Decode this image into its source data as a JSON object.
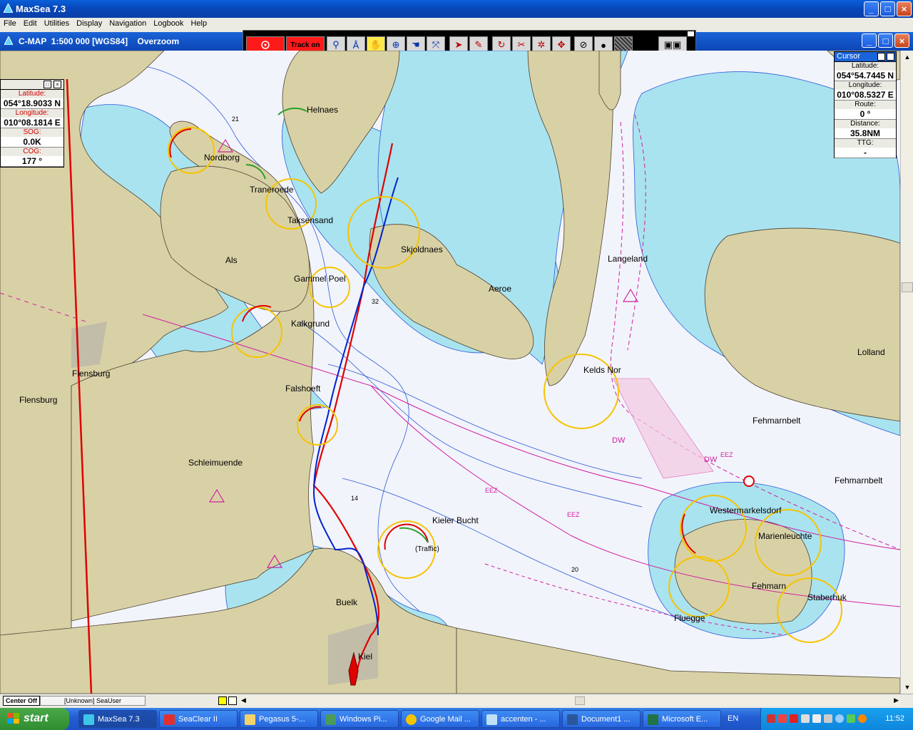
{
  "window": {
    "title": "MaxSea 7.3"
  },
  "menu": [
    "File",
    "Edit",
    "Utilities",
    "Display",
    "Navigation",
    "Logbook",
    "Help"
  ],
  "chart_header": {
    "title": "C-MAP  1:500 000 [WGS84]    Overzoom"
  },
  "toolbar": {
    "track_label": "Track on"
  },
  "nav_panel": {
    "latitude_label": "Latitude:",
    "latitude": "054°18.9033 N",
    "longitude_label": "Longitude:",
    "longitude": "010°08.1814 E",
    "sog_label": "SOG:",
    "sog": "0.0K",
    "cog_label": "COG:",
    "cog": "177 °"
  },
  "cursor_panel": {
    "title": "Cursor",
    "latitude_label": "Latitude:",
    "latitude": "054°54.7445 N",
    "longitude_label": "Longitude:",
    "longitude": "010°08.5327 E",
    "route_label": "Route:",
    "route": "0 °",
    "distance_label": "Distance:",
    "distance": "35.8NM",
    "ttg_label": "TTG:",
    "ttg": "-"
  },
  "places": {
    "helnaes": "Helnaes",
    "nordborg": "Nordborg",
    "traneroede": "Traneroede",
    "taksensand": "Taksensand",
    "skjoldnaes": "Skjoldnaes",
    "als": "Als",
    "gammel_poel": "Gammel Poel",
    "aeroe": "Aeroe",
    "langeland": "Langeland",
    "kalkgrund": "Kalkgrund",
    "flensburg_1": "Flensburg",
    "flensburg_2": "Flensburg",
    "falshoeft": "Falshoeft",
    "keldsnor": "Kelds Nor",
    "lolland": "Lolland",
    "fehmarnbelt_1": "Fehmarnbelt",
    "fehmarnbelt_2": "Fehmarnbelt",
    "schleimuende": "Schleimuende",
    "kieler_bucht": "Kieler Bucht",
    "traffic": "(Traffic)",
    "westermarkelsdorf": "Westermarkelsdorf",
    "marienleuchte": "Marienleuchte",
    "fehmarn": "Fehmarn",
    "staberhuk": "Staberhuk",
    "buelk": "Buelk",
    "fluegge": "Fluegge",
    "kiel": "Kiel"
  },
  "depths": {
    "d21": "21",
    "d32": "32",
    "d14": "14",
    "d20": "20",
    "eez1": "EEZ",
    "eez2": "EEZ",
    "eez3": "EEZ",
    "dw1": "DW",
    "dw2": "DW"
  },
  "statusbar": {
    "center_off": "Center Off",
    "user": "[Unknown] SeaUser"
  },
  "taskbar": {
    "start": "start",
    "tasks": [
      "MaxSea 7.3",
      "SeaClear II",
      "Pegasus 5-...",
      "Windows Pi...",
      "Google Mail ...",
      "accenten - ...",
      "Document1 ...",
      "Microsoft E..."
    ],
    "language": "EN",
    "clock": "11:52"
  },
  "colors": {
    "land": "#d9d1a6",
    "shallow": "#a9e3ef",
    "deep": "#f2f4fb",
    "track_red": "#e00000",
    "track_blue": "#0022cc",
    "eez": "#d020a0",
    "light_yellow": "#f5c400"
  }
}
